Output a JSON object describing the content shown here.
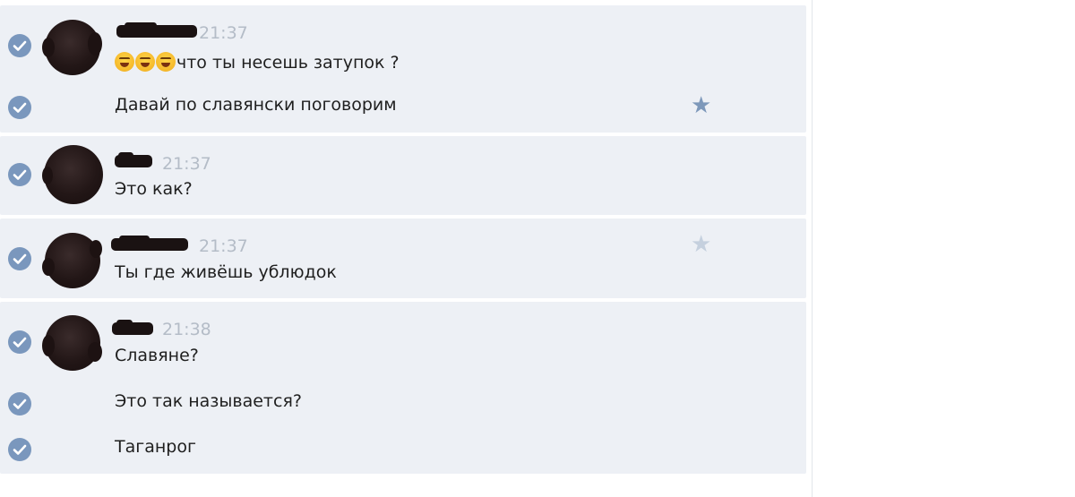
{
  "colors": {
    "message_bg": "#edf0f5",
    "check_blue": "#7a97bd",
    "time_grey": "#b4bcc7",
    "text": "#1f1f1f"
  },
  "groups": [
    {
      "time": "21:37",
      "messages": [
        {
          "emoji": [
            "grinning-squinting-face",
            "grinning-squinting-face",
            "grinning-squinting-face"
          ],
          "text": "что ты несешь затупок ?"
        },
        {
          "text": "Давай по славянски поговорим",
          "starred": true
        }
      ]
    },
    {
      "time": "21:37",
      "messages": [
        {
          "text": "Это как?"
        }
      ]
    },
    {
      "time": "21:37",
      "messages": [
        {
          "text": "Ты где живёшь ублюдок",
          "starred": false
        }
      ]
    },
    {
      "time": "21:38",
      "messages": [
        {
          "text": "Славяне?"
        },
        {
          "text": "Это так называется?"
        },
        {
          "text": "Таганрог"
        }
      ]
    }
  ],
  "icons": {
    "select": "check-circle-icon",
    "favorite": "star-icon"
  }
}
